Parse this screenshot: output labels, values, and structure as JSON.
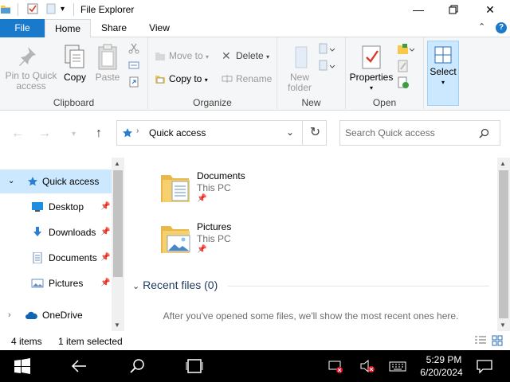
{
  "window": {
    "title": "File Explorer",
    "minimize_icon": "minimize-icon",
    "maximize_icon": "restore-icon",
    "close_icon": "close-icon"
  },
  "ribbon_tabs": [
    {
      "label": "File",
      "active": false
    },
    {
      "label": "Home",
      "active": true
    },
    {
      "label": "Share",
      "active": false
    },
    {
      "label": "View",
      "active": false
    }
  ],
  "ribbon": {
    "clipboard": {
      "label": "Clipboard",
      "pin_to_quick_access_line1": "Pin to Quick",
      "pin_to_quick_access_line2": "access",
      "copy": "Copy",
      "paste": "Paste"
    },
    "organize": {
      "label": "Organize",
      "move_to": "Move to",
      "copy_to": "Copy to",
      "delete": "Delete",
      "rename": "Rename"
    },
    "new": {
      "label": "New",
      "new_folder_line1": "New",
      "new_folder_line2": "folder"
    },
    "open": {
      "label": "Open",
      "properties": "Properties"
    },
    "select": {
      "label": "Select"
    }
  },
  "address_bar": {
    "location": "Quick access"
  },
  "search": {
    "placeholder": "Search Quick access"
  },
  "nav_pane": {
    "items": [
      {
        "label": "Quick access",
        "icon": "star-icon",
        "selected": true
      },
      {
        "label": "Desktop",
        "icon": "desktop-icon",
        "pinned": true
      },
      {
        "label": "Downloads",
        "icon": "download-icon",
        "pinned": true
      },
      {
        "label": "Documents",
        "icon": "documents-icon",
        "pinned": true
      },
      {
        "label": "Pictures",
        "icon": "pictures-icon",
        "pinned": true
      },
      {
        "label": "OneDrive",
        "icon": "cloud-icon"
      }
    ]
  },
  "content": {
    "folders": [
      {
        "name": "Documents",
        "location": "This PC"
      },
      {
        "name": "Pictures",
        "location": "This PC"
      }
    ],
    "recent_header": "Recent files (0)",
    "recent_empty": "After you've opened some files, we'll show the most recent ones here."
  },
  "status": {
    "items": "4 items",
    "selected": "1 item selected"
  },
  "taskbar": {
    "time": "5:29 PM",
    "date": "6/20/2024"
  },
  "colors": {
    "accent": "#1979ca",
    "selection": "#cce8ff",
    "taskbar": "#000000"
  }
}
